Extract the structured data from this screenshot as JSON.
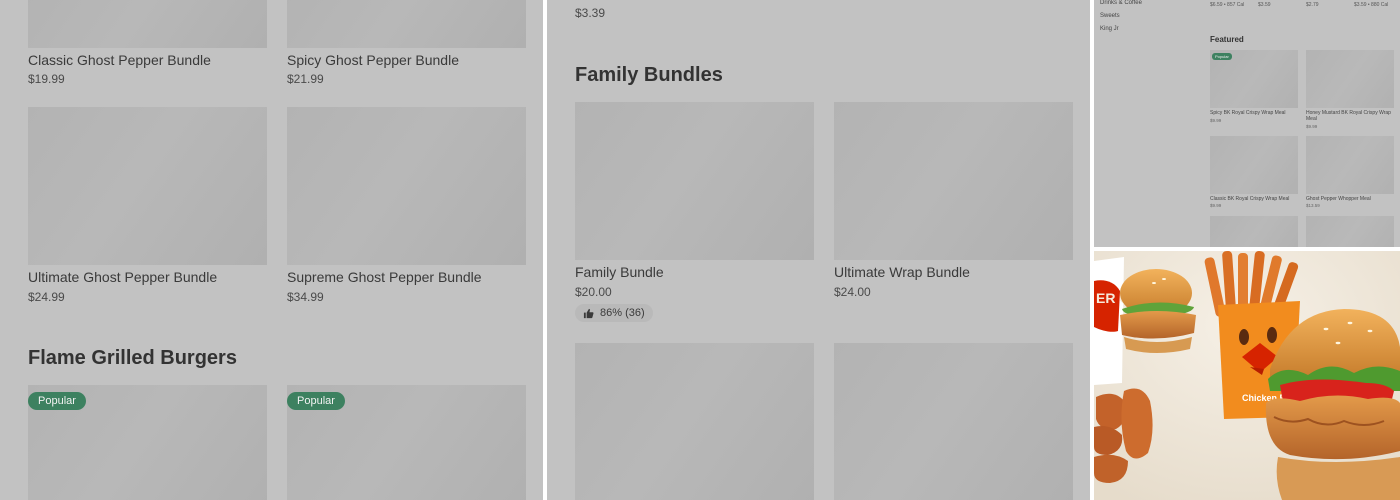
{
  "panel1": {
    "items_top": [
      {
        "name": "Classic Ghost Pepper Bundle",
        "price": "$19.99"
      },
      {
        "name": "Spicy Ghost Pepper Bundle",
        "price": "$21.99"
      }
    ],
    "items_mid": [
      {
        "name": "Ultimate Ghost Pepper Bundle",
        "price": "$24.99"
      },
      {
        "name": "Supreme Ghost Pepper Bundle",
        "price": "$34.99"
      }
    ],
    "section_title": "Flame Grilled Burgers",
    "badges": [
      "Popular",
      "Popular"
    ]
  },
  "panel2": {
    "top_price": "$3.39",
    "section_title": "Family Bundles",
    "items": [
      {
        "name": "Family Bundle",
        "price": "$20.00",
        "rating": "86% (36)"
      },
      {
        "name": "Ultimate Wrap Bundle",
        "price": "$24.00"
      }
    ]
  },
  "panel3": {
    "categories": [
      "Drinks & Coffee",
      "Sweets",
      "King Jr"
    ],
    "top_prices": [
      "$6.59 • 857 Cal",
      "$3.59",
      "$2.79",
      "$3.59 • 880 Cal"
    ],
    "featured_title": "Featured",
    "badge": "Popular",
    "items": [
      {
        "name": "Spicy BK Royal Crispy Wrap Meal",
        "price": "$9.99"
      },
      {
        "name": "Honey Mustard BK Royal Crispy Wrap Meal",
        "price": "$9.99"
      },
      {
        "name": "Classic BK Royal Crispy Wrap Meal",
        "price": "$9.99"
      },
      {
        "name": "Ghost Pepper Whopper Meal",
        "price": "$13.59"
      }
    ]
  },
  "panel4": {
    "box_text": "Chicken Fries",
    "cup_text": "ER G"
  },
  "colors": {
    "overlay_gray": "#c2c2c2",
    "badge_green": "#3d8160",
    "promo_bg": "#ece4d8",
    "box_orange": "#f28c1e"
  }
}
